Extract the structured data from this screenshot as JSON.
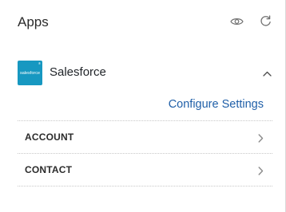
{
  "header": {
    "title": "Apps",
    "icons": [
      "eye-icon",
      "refresh-icon"
    ]
  },
  "app": {
    "name": "Salesforce",
    "logo_text": "salesforce",
    "logo_mark": "®",
    "logo_color": "#1798c1",
    "expanded": true
  },
  "configure_link": "Configure Settings",
  "objects": [
    {
      "label": "ACCOUNT"
    },
    {
      "label": "CONTACT"
    }
  ],
  "colors": {
    "link": "#1f5fa8",
    "icon": "#7a7a7a"
  }
}
